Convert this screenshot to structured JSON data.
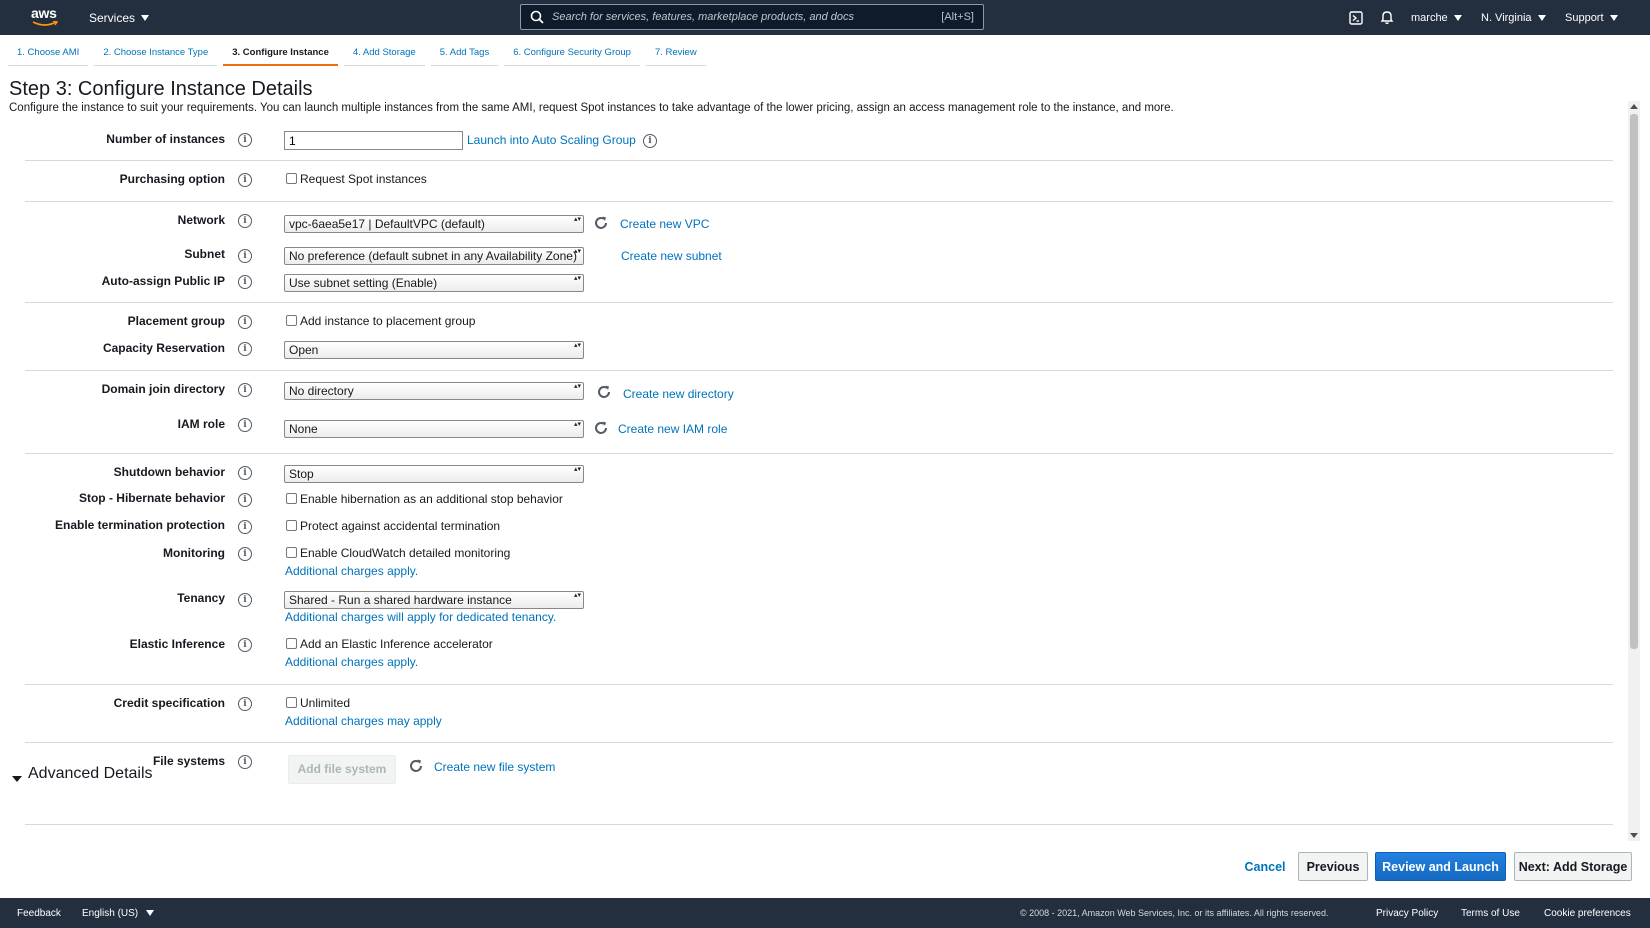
{
  "topbar": {
    "logo_text": "aws",
    "services_label": "Services",
    "search_placeholder": "Search for services, features, marketplace products, and docs",
    "search_shortcut": "[Alt+S]",
    "user_label": "marche",
    "region_label": "N. Virginia",
    "support_label": "Support"
  },
  "steps": [
    {
      "label": "1. Choose AMI"
    },
    {
      "label": "2. Choose Instance Type"
    },
    {
      "label": "3. Configure Instance",
      "active": true
    },
    {
      "label": "4. Add Storage"
    },
    {
      "label": "5. Add Tags"
    },
    {
      "label": "6. Configure Security Group"
    },
    {
      "label": "7. Review"
    }
  ],
  "page": {
    "title": "Step 3: Configure Instance Details",
    "description": "Configure the instance to suit your requirements. You can launch multiple instances from the same AMI, request Spot instances to take advantage of the lower pricing, assign an access management role to the instance, and more."
  },
  "form": {
    "number_of_instances": {
      "label": "Number of instances",
      "value": "1",
      "link": "Launch into Auto Scaling Group"
    },
    "purchasing_option": {
      "label": "Purchasing option",
      "checkbox": "Request Spot instances"
    },
    "network": {
      "label": "Network",
      "value": "vpc-6aea5e17 | DefaultVPC (default)",
      "link": "Create new VPC"
    },
    "subnet": {
      "label": "Subnet",
      "value": "No preference (default subnet in any Availability Zone)",
      "link": "Create new subnet"
    },
    "auto_assign_ip": {
      "label": "Auto-assign Public IP",
      "value": "Use subnet setting (Enable)"
    },
    "placement_group": {
      "label": "Placement group",
      "checkbox": "Add instance to placement group"
    },
    "capacity_reservation": {
      "label": "Capacity Reservation",
      "value": "Open"
    },
    "domain_join": {
      "label": "Domain join directory",
      "value": "No directory",
      "link": "Create new directory"
    },
    "iam_role": {
      "label": "IAM role",
      "value": "None",
      "link": "Create new IAM role"
    },
    "shutdown_behavior": {
      "label": "Shutdown behavior",
      "value": "Stop"
    },
    "hibernate_behavior": {
      "label": "Stop - Hibernate behavior",
      "checkbox": "Enable hibernation as an additional stop behavior"
    },
    "termination_protection": {
      "label": "Enable termination protection",
      "checkbox": "Protect against accidental termination"
    },
    "monitoring": {
      "label": "Monitoring",
      "checkbox": "Enable CloudWatch detailed monitoring",
      "note": "Additional charges apply."
    },
    "tenancy": {
      "label": "Tenancy",
      "value": "Shared - Run a shared hardware instance",
      "note": "Additional charges will apply for dedicated tenancy."
    },
    "elastic_inference": {
      "label": "Elastic Inference",
      "checkbox": "Add an Elastic Inference accelerator",
      "note": "Additional charges apply."
    },
    "credit_specification": {
      "label": "Credit specification",
      "checkbox": "Unlimited",
      "note": "Additional charges may apply"
    },
    "file_systems": {
      "label": "File systems",
      "button": "Add file system",
      "link": "Create new file system"
    },
    "advanced_details": {
      "title": "Advanced Details"
    }
  },
  "info_glyph": "i",
  "actions": {
    "cancel": "Cancel",
    "previous": "Previous",
    "review_launch": "Review and Launch",
    "next": "Next: Add Storage"
  },
  "footer": {
    "feedback": "Feedback",
    "language": "English (US)",
    "copyright": "© 2008 - 2021, Amazon Web Services, Inc. or its affiliates. All rights reserved.",
    "privacy": "Privacy Policy",
    "terms": "Terms of Use",
    "cookies": "Cookie preferences"
  },
  "colors": {
    "header_bg": "#232f3e",
    "link": "#0073bb",
    "active_step": "#ec7211",
    "primary_button": "#1473e6"
  }
}
